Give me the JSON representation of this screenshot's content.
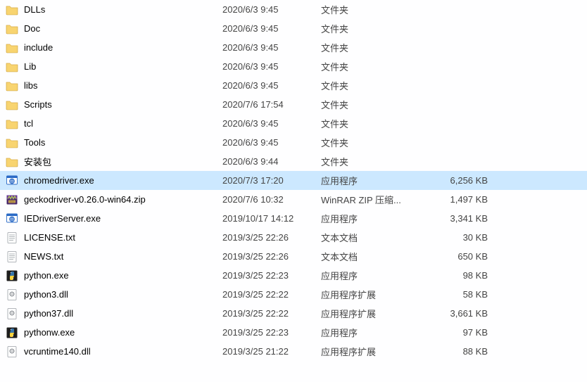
{
  "files": [
    {
      "icon": "folder",
      "name": "DLLs",
      "date": "2020/6/3 9:45",
      "type": "文件夹",
      "size": ""
    },
    {
      "icon": "folder",
      "name": "Doc",
      "date": "2020/6/3 9:45",
      "type": "文件夹",
      "size": ""
    },
    {
      "icon": "folder",
      "name": "include",
      "date": "2020/6/3 9:45",
      "type": "文件夹",
      "size": ""
    },
    {
      "icon": "folder",
      "name": "Lib",
      "date": "2020/6/3 9:45",
      "type": "文件夹",
      "size": ""
    },
    {
      "icon": "folder",
      "name": "libs",
      "date": "2020/6/3 9:45",
      "type": "文件夹",
      "size": ""
    },
    {
      "icon": "folder",
      "name": "Scripts",
      "date": "2020/7/6 17:54",
      "type": "文件夹",
      "size": ""
    },
    {
      "icon": "folder",
      "name": "tcl",
      "date": "2020/6/3 9:45",
      "type": "文件夹",
      "size": ""
    },
    {
      "icon": "folder",
      "name": "Tools",
      "date": "2020/6/3 9:45",
      "type": "文件夹",
      "size": ""
    },
    {
      "icon": "folder",
      "name": "安装包",
      "date": "2020/6/3 9:44",
      "type": "文件夹",
      "size": ""
    },
    {
      "icon": "exe-ie",
      "name": "chromedriver.exe",
      "date": "2020/7/3 17:20",
      "type": "应用程序",
      "size": "6,256 KB",
      "selected": true
    },
    {
      "icon": "winrar",
      "name": "geckodriver-v0.26.0-win64.zip",
      "date": "2020/7/6 10:32",
      "type": "WinRAR ZIP 压缩...",
      "size": "1,497 KB"
    },
    {
      "icon": "exe-ie",
      "name": "IEDriverServer.exe",
      "date": "2019/10/17 14:12",
      "type": "应用程序",
      "size": "3,341 KB"
    },
    {
      "icon": "text",
      "name": "LICENSE.txt",
      "date": "2019/3/25 22:26",
      "type": "文本文档",
      "size": "30 KB"
    },
    {
      "icon": "text",
      "name": "NEWS.txt",
      "date": "2019/3/25 22:26",
      "type": "文本文档",
      "size": "650 KB"
    },
    {
      "icon": "python",
      "name": "python.exe",
      "date": "2019/3/25 22:23",
      "type": "应用程序",
      "size": "98 KB"
    },
    {
      "icon": "dll",
      "name": "python3.dll",
      "date": "2019/3/25 22:22",
      "type": "应用程序扩展",
      "size": "58 KB"
    },
    {
      "icon": "dll",
      "name": "python37.dll",
      "date": "2019/3/25 22:22",
      "type": "应用程序扩展",
      "size": "3,661 KB"
    },
    {
      "icon": "python",
      "name": "pythonw.exe",
      "date": "2019/3/25 22:23",
      "type": "应用程序",
      "size": "97 KB"
    },
    {
      "icon": "dll",
      "name": "vcruntime140.dll",
      "date": "2019/3/25 21:22",
      "type": "应用程序扩展",
      "size": "88 KB"
    }
  ]
}
